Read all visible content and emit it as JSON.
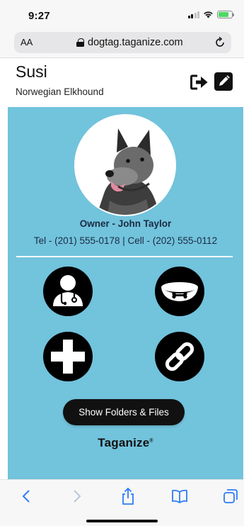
{
  "status_bar": {
    "time": "9:27",
    "battery_level": 0.8
  },
  "browser": {
    "aa_label": "AA",
    "url": "dogtag.taganize.com"
  },
  "header": {
    "pet_name": "Susi",
    "breed": "Norwegian Elkhound"
  },
  "profile": {
    "owner": "Owner - John Taylor",
    "phones": "Tel - (201) 555-0178 | Cell - (202) 555-0112"
  },
  "actions": [
    {
      "icon": "veterinarian-icon"
    },
    {
      "icon": "dog-bowl-icon"
    },
    {
      "icon": "medical-cross-icon"
    },
    {
      "icon": "link-icon"
    }
  ],
  "folders_button_label": "Show Folders & Files",
  "brand": "Taganize",
  "brand_mark": "®",
  "colors": {
    "accent_background": "#72c3dc",
    "button": "#000000",
    "ios_blue": "#2f7cf6"
  }
}
